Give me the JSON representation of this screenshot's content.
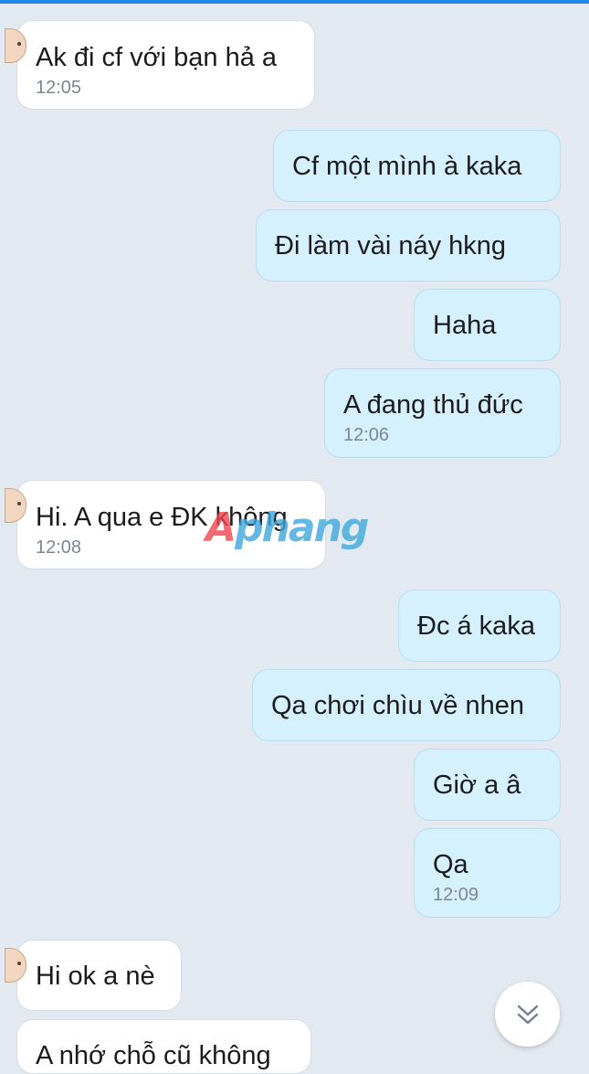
{
  "messages": [
    {
      "text": "Ak đi cf với bạn hả a",
      "time": "12:05"
    },
    {
      "text": "Cf một mình à kaka"
    },
    {
      "text": "Đi làm vài náy hkng"
    },
    {
      "text": "Haha"
    },
    {
      "text": "A đang thủ đức",
      "time": "12:06"
    },
    {
      "text": "Hi. A qua e ĐK không",
      "time": "12:08"
    },
    {
      "text": "Đc á kaka"
    },
    {
      "text": "Qa chơi chìu về nhen"
    },
    {
      "text": "Giờ a â"
    },
    {
      "text": "Qa",
      "time": "12:09"
    },
    {
      "text": "Hi ok a nè"
    },
    {
      "text": "A nhớ chỗ cũ không"
    }
  ],
  "watermark": {
    "first_letter": "A",
    "rest": "phang"
  },
  "icons": {
    "scroll_down": "double-chevron-down-icon",
    "avatar": "avatar"
  },
  "colors": {
    "incoming_bubble": "#ffffff",
    "outgoing_bubble": "#d5f1ff",
    "background": "#e2e9f1",
    "accent": "#1e88e5"
  }
}
